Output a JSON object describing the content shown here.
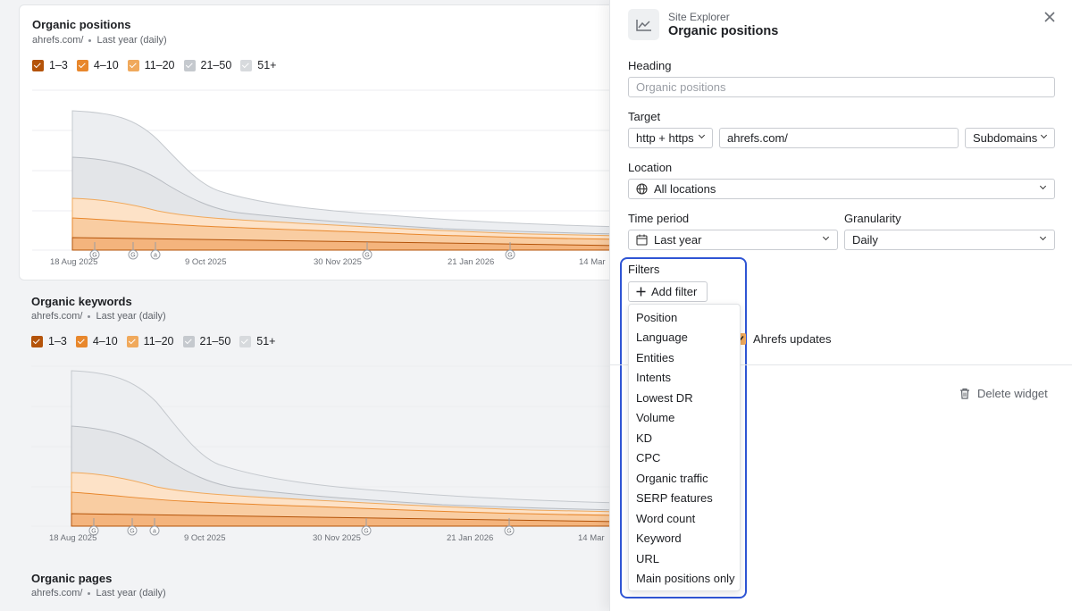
{
  "colors": {
    "band_1_3": "#b45309",
    "band_4_10": "#e8872c",
    "band_11_20": "#f0a95c",
    "band_21_50": "#c5c9ce",
    "band_51": "#d7dadd",
    "focus_ring": "#2f55d4"
  },
  "cards": [
    {
      "title": "Organic positions",
      "domain": "ahrefs.com/",
      "period": "Last year (daily)",
      "legend": [
        "1–3",
        "4–10",
        "11–20",
        "21–50",
        "51+"
      ],
      "x_ticks": [
        "18 Aug 2025",
        "9 Oct 2025",
        "30 Nov 2025",
        "21 Jan 2026",
        "14 Mar"
      ],
      "markers": [
        "G",
        "G",
        "a",
        "G",
        "G"
      ]
    },
    {
      "title": "Organic keywords",
      "domain": "ahrefs.com/",
      "period": "Last year (daily)",
      "legend": [
        "1–3",
        "4–10",
        "11–20",
        "21–50",
        "51+"
      ],
      "x_ticks": [
        "18 Aug 2025",
        "9 Oct 2025",
        "30 Nov 2025",
        "21 Jan 2026",
        "14 Mar"
      ],
      "markers": [
        "G",
        "G",
        "a",
        "G",
        "G"
      ]
    },
    {
      "title": "Organic pages",
      "domain": "ahrefs.com/",
      "period": "Last year (daily)"
    }
  ],
  "panel": {
    "kicker": "Site Explorer",
    "title": "Organic positions",
    "heading_label": "Heading",
    "heading_placeholder": "Organic positions",
    "target_label": "Target",
    "protocol": "http + https",
    "target_value": "ahrefs.com/",
    "mode": "Subdomains",
    "location_label": "Location",
    "location_value": "All locations",
    "time_label": "Time period",
    "time_value": "Last year",
    "granularity_label": "Granularity",
    "granularity_value": "Daily",
    "filters_label": "Filters",
    "add_filter": "Add filter",
    "filter_options": [
      "Position",
      "Language",
      "Entities",
      "Intents",
      "Lowest DR",
      "Volume",
      "KD",
      "CPC",
      "Organic traffic",
      "SERP features",
      "Word count",
      "Keyword",
      "URL",
      "Main positions only"
    ],
    "updates_label": "Ahrefs updates",
    "delete_label": "Delete widget"
  }
}
